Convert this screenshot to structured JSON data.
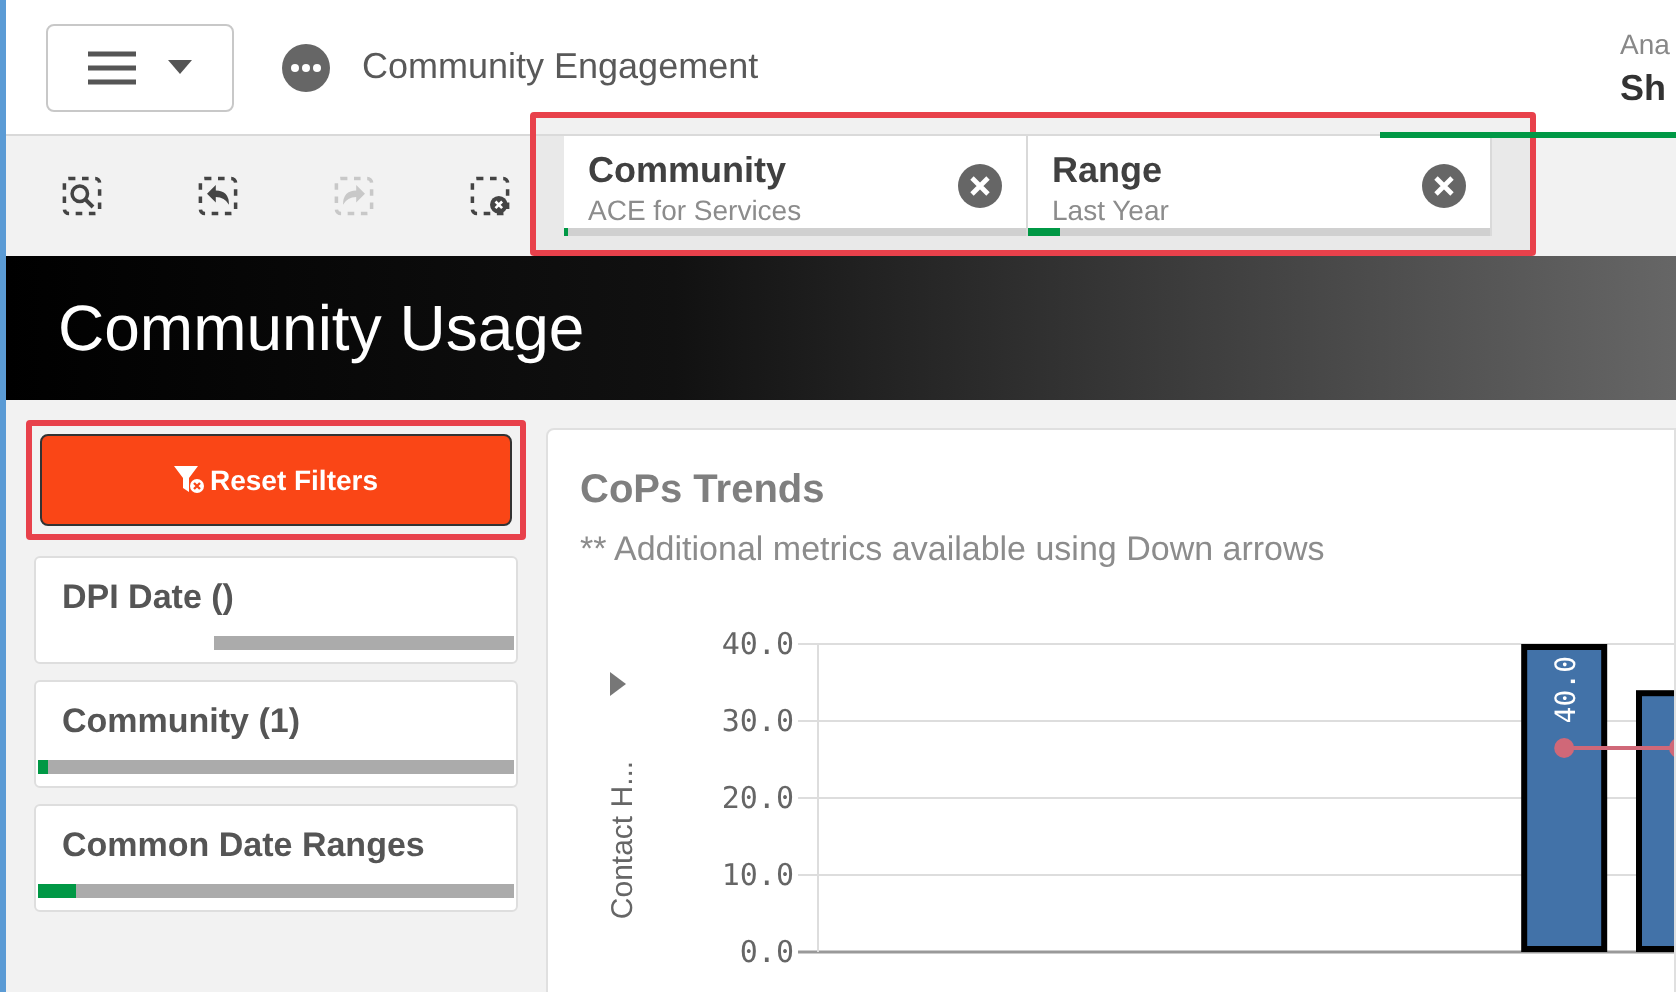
{
  "header": {
    "app_title": "Community Engagement",
    "right_label": "Ana",
    "right_value": "Sh"
  },
  "toolbar": {
    "tools": [
      {
        "kind": "search",
        "disabled": false
      },
      {
        "kind": "back",
        "disabled": false
      },
      {
        "kind": "forward",
        "disabled": true
      },
      {
        "kind": "clear",
        "disabled": false
      }
    ]
  },
  "selections": [
    {
      "field": "Community",
      "value": "ACE for Services",
      "level": 0.01
    },
    {
      "field": "Range",
      "value": "Last Year",
      "level": 0.07
    }
  ],
  "sheet_title": "Community Usage",
  "reset_button": "Reset Filters",
  "filters": [
    {
      "label": "DPI Date ()",
      "kind": "possible",
      "level": 0.37
    },
    {
      "label": "Community (1)",
      "kind": "selected",
      "level": 0.02
    },
    {
      "label": "Common Date Ranges",
      "kind": "selected",
      "level": 0.08
    }
  ],
  "chart": {
    "title": "CoPs Trends",
    "subtitle": "** Additional metrics available using Down arrows",
    "chart_data": {
      "type": "bar",
      "ylabel": "Contact H...",
      "ylim": [
        0,
        40
      ],
      "grid": true,
      "yticks": [
        {
          "value": 0,
          "label": "0.0"
        },
        {
          "value": 10,
          "label": "10.0"
        },
        {
          "value": 20,
          "label": "20.0"
        },
        {
          "value": 30,
          "label": "30.0"
        },
        {
          "value": 40,
          "label": "40.0"
        }
      ],
      "series": [
        {
          "type": "bar",
          "color": "#4272a8",
          "values": [
            null,
            null,
            null,
            null,
            null,
            null,
            40,
            34
          ]
        },
        {
          "type": "line",
          "color": "#d06878",
          "marker": "circle",
          "values": [
            null,
            null,
            null,
            null,
            null,
            null,
            26.5,
            26.5
          ]
        }
      ],
      "value_labels": [
        null,
        null,
        null,
        null,
        null,
        null,
        "40.0",
        null
      ]
    }
  }
}
